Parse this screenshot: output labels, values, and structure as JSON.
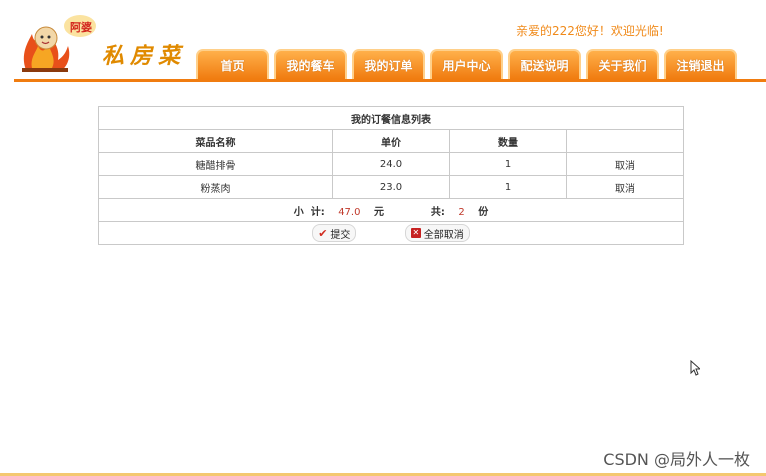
{
  "header": {
    "logo_badge": "阿婆",
    "logo_text": "私房菜",
    "greeting": "亲爱的222您好！欢迎光临!"
  },
  "nav": {
    "tabs": [
      "首页",
      "我的餐车",
      "我的订单",
      "用户中心",
      "配送说明",
      "关于我们",
      "注销退出"
    ]
  },
  "orders": {
    "caption": "我的订餐信息列表",
    "columns": [
      "菜品名称",
      "单价",
      "数量",
      ""
    ],
    "rows": [
      {
        "name": "糖醋排骨",
        "price": "24.0",
        "qty": "1",
        "action": "取消"
      },
      {
        "name": "粉蒸肉",
        "price": "23.0",
        "qty": "1",
        "action": "取消"
      }
    ],
    "subtotal_label": "小  计:",
    "subtotal_value": "47.0",
    "currency": "元",
    "count_label": "共:",
    "count_value": "2",
    "count_unit": "份",
    "submit_label": "提交",
    "cancel_all_label": "全部取消"
  },
  "watermark": "CSDN @局外人一枚",
  "colors": {
    "accent": "#f07c10",
    "text_highlight": "#c0392b"
  }
}
